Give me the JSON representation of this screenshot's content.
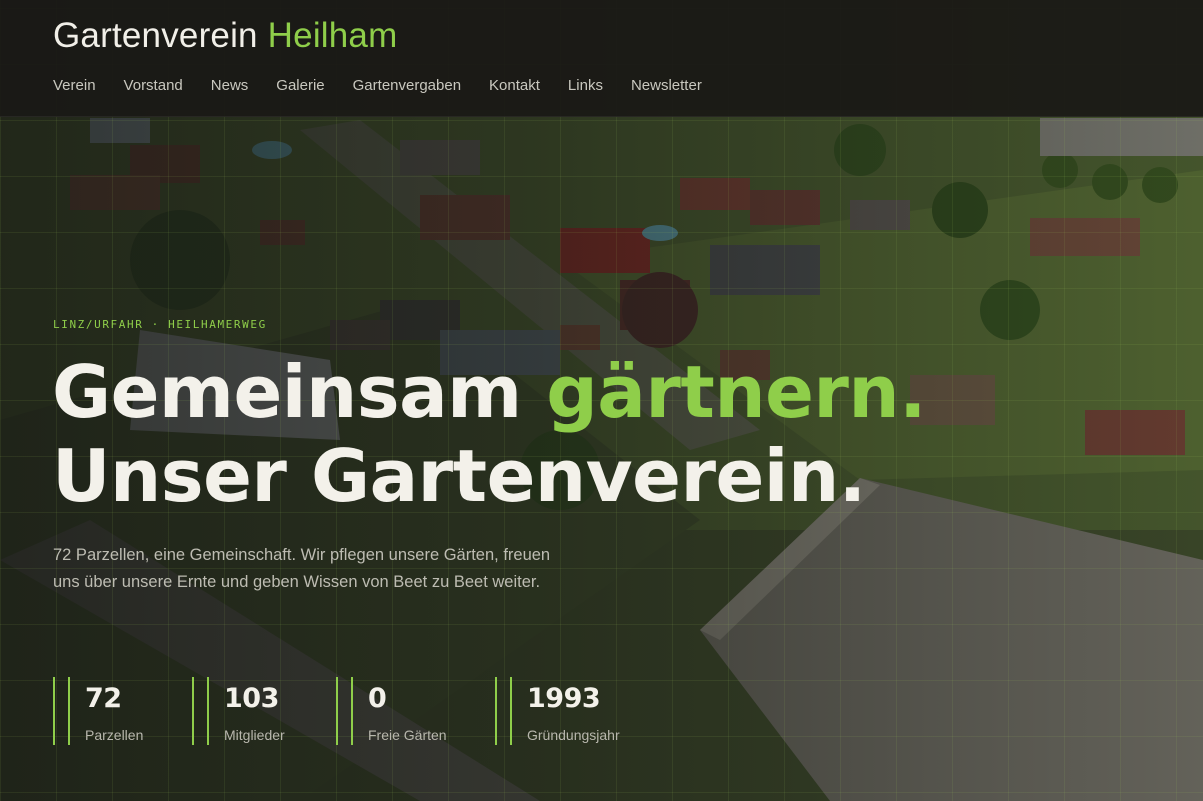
{
  "header": {
    "brand_primary": "Gartenverein",
    "brand_accent": "Heilham",
    "nav": [
      "Verein",
      "Vorstand",
      "News",
      "Galerie",
      "Gartenvergaben",
      "Kontakt",
      "Links",
      "Newsletter"
    ]
  },
  "hero": {
    "eyebrow": "LINZ/URFAHR · HEILHAMERWEG",
    "headline_line1_start": "Gemeinsam",
    "headline_line1_accent": "gärtnern.",
    "headline_line2": "Unser Gartenverein.",
    "lead": "72 Parzellen, eine Gemeinschaft. Wir pflegen unsere Gärten, freuen uns über unsere Ernte und geben Wissen von Beet zu Beet weiter."
  },
  "stats": [
    {
      "value": "72",
      "label": "Parzellen"
    },
    {
      "value": "103",
      "label": "Mitglieder"
    },
    {
      "value": "0",
      "label": "Freie Gärten"
    },
    {
      "value": "1993",
      "label": "Gründungsjahr"
    }
  ],
  "colors": {
    "accent": "#8fce4a",
    "text": "#f1efe8",
    "header_bg": "#1a1916"
  }
}
